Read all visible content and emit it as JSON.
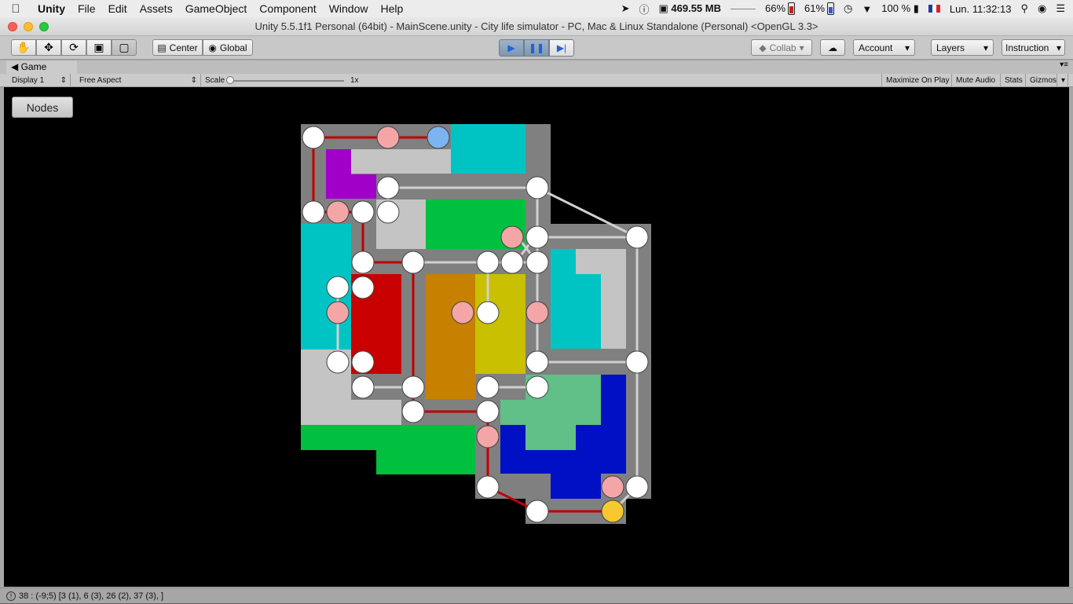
{
  "menubar": {
    "app_name": "Unity",
    "items": [
      "File",
      "Edit",
      "Assets",
      "GameObject",
      "Component",
      "Window",
      "Help"
    ],
    "memory": "469.55 MB",
    "cpu_percent": "66%",
    "battery_percent": "61%",
    "wifi_battery": "100 %",
    "clock": "Lun. 11:32:13"
  },
  "window": {
    "title": "Unity 5.5.1f1 Personal (64bit) - MainScene.unity - City life simulator - PC, Mac & Linux Standalone (Personal) <OpenGL 3.3>"
  },
  "toolbar": {
    "tools": [
      "hand-tool",
      "move-tool",
      "rotate-tool",
      "scale-tool",
      "rect-tool"
    ],
    "active_tool": "rect-tool",
    "pivot_label": "Center",
    "space_label": "Global",
    "collab_label": "Collab",
    "account_label": "Account",
    "layers_label": "Layers",
    "layout_label": "Instruction"
  },
  "game_tab": {
    "label": "Game",
    "display": "Display 1",
    "aspect": "Free Aspect",
    "scale_label": "Scale",
    "scale_value": "1x",
    "maximize_on_play": "Maximize On Play",
    "mute_audio": "Mute Audio",
    "stats": "Stats",
    "gizmos": "Gizmos"
  },
  "viewport": {
    "nodes_button": "Nodes",
    "colors": {
      "road": "#808080",
      "red_path": "#c00000",
      "white_path": "#d0d0d0",
      "node_white": "#ffffff",
      "node_pink": "#f4a6a6",
      "node_blue": "#7bb4f0",
      "node_yellow": "#f7c830",
      "cyan": "#00c4c4",
      "purple": "#a000c8",
      "light_gray": "#c4c4c4",
      "green": "#00c040",
      "red_block": "#c80000",
      "orange": "#c88000",
      "yellow": "#c8c000",
      "mint": "#60c088",
      "blue": "#0010c4"
    }
  },
  "status": {
    "text": "38 : (-9;5) [3 (1), 6 (3), 26 (2), 37 (3), ]"
  }
}
